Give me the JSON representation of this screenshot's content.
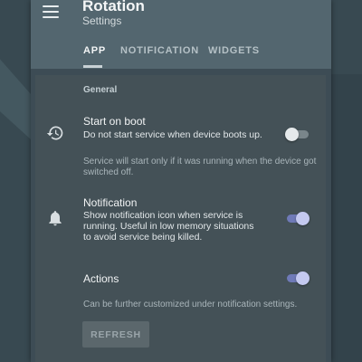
{
  "app_bar": {
    "title": "Rotation",
    "subtitle": "Settings"
  },
  "tabs": [
    {
      "label": "APP",
      "active": true
    },
    {
      "label": "NOTIFICATION",
      "active": false
    },
    {
      "label": "WIDGETS",
      "active": false
    }
  ],
  "section": {
    "title": "General"
  },
  "prefs": {
    "start_on_boot": {
      "icon": "restore-icon",
      "title": "Start on boot",
      "summary": "Do not start service when device boots up.",
      "note": "Service will start only if it was running when the device got switched off.",
      "enabled": false
    },
    "notification": {
      "icon": "bell-icon",
      "title": "Notification",
      "summary": "Show notification icon when service is running. Useful in low memory situations to avoid service being killed.",
      "enabled": true
    },
    "actions": {
      "title": "Actions",
      "note": "Can be further customized under notification settings.",
      "enabled": true
    }
  },
  "refresh_button": {
    "label": "REFRESH"
  },
  "colors": {
    "app_bar": "#53666f",
    "panel": "#445157",
    "accent": "#6f7ab8"
  }
}
